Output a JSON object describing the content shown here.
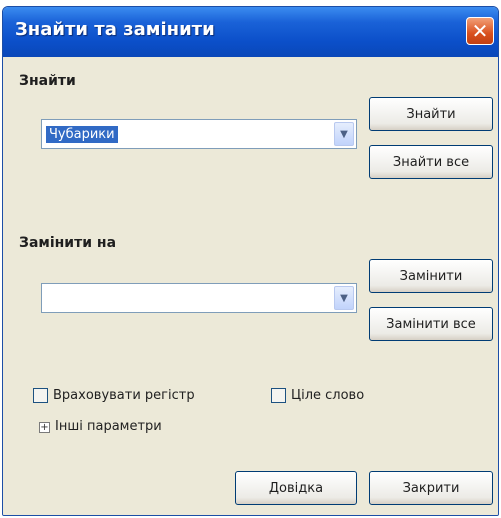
{
  "dialog": {
    "title": "Знайти та замінити",
    "close_icon": "close-icon",
    "find": {
      "label": "Знайти",
      "value": "Чубарики"
    },
    "replace": {
      "label": "Замінити на",
      "value": ""
    },
    "buttons": {
      "find": "Знайти",
      "find_all": "Знайти все",
      "replace": "Замінити",
      "replace_all": "Замінити все",
      "help": "Довідка",
      "close": "Закрити"
    },
    "options": {
      "match_case": "Враховувати регістр",
      "whole_word": "Ціле слово",
      "other_params": "Інші параметри"
    }
  },
  "colors": {
    "titlebar": "#0b4fc9",
    "close": "#d9501e",
    "dialog_bg": "#ece9d8",
    "selection": "#316ac5"
  }
}
